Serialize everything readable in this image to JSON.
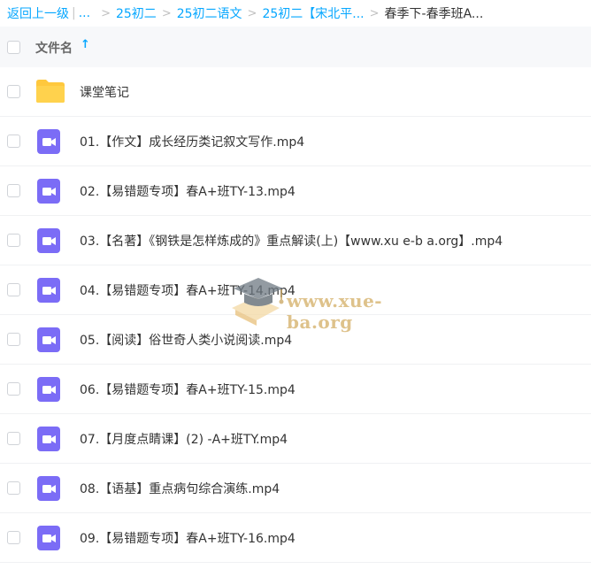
{
  "breadcrumb": {
    "back_label": "返回上一级",
    "ellipsis": "...",
    "crumbs": [
      "25初二",
      "25初二语文",
      "25初二【宋北平..."
    ],
    "current": "春季下-春季班A..."
  },
  "header": {
    "column_label": "文件名",
    "sort_icon": "arrow-up-icon"
  },
  "files": [
    {
      "name": "课堂笔记",
      "type": "folder"
    },
    {
      "name": "01.【作文】成长经历类记叙文写作.mp4",
      "type": "video"
    },
    {
      "name": "02.【易错题专项】春A+班TY-13.mp4",
      "type": "video"
    },
    {
      "name": "03.【名著】《钢铁是怎样炼成的》重点解读(上)【www.xu e-b a.org】.mp4",
      "type": "video"
    },
    {
      "name": "04.【易错题专项】春A+班TY-14.mp4",
      "type": "video"
    },
    {
      "name": "05.【阅读】俗世奇人类小说阅读.mp4",
      "type": "video"
    },
    {
      "name": "06.【易错题专项】春A+班TY-15.mp4",
      "type": "video"
    },
    {
      "name": "07.【月度点睛课】(2) -A+班TY.mp4",
      "type": "video"
    },
    {
      "name": "08.【语基】重点病句综合演练.mp4",
      "type": "video"
    },
    {
      "name": "09.【易错题专项】春A+班TY-16.mp4",
      "type": "video"
    }
  ],
  "watermark": {
    "text": "www.xue-ba.org"
  },
  "colors": {
    "accent": "#06a7ff",
    "folder": "#ffc83d",
    "video": "#7b6cf6"
  }
}
